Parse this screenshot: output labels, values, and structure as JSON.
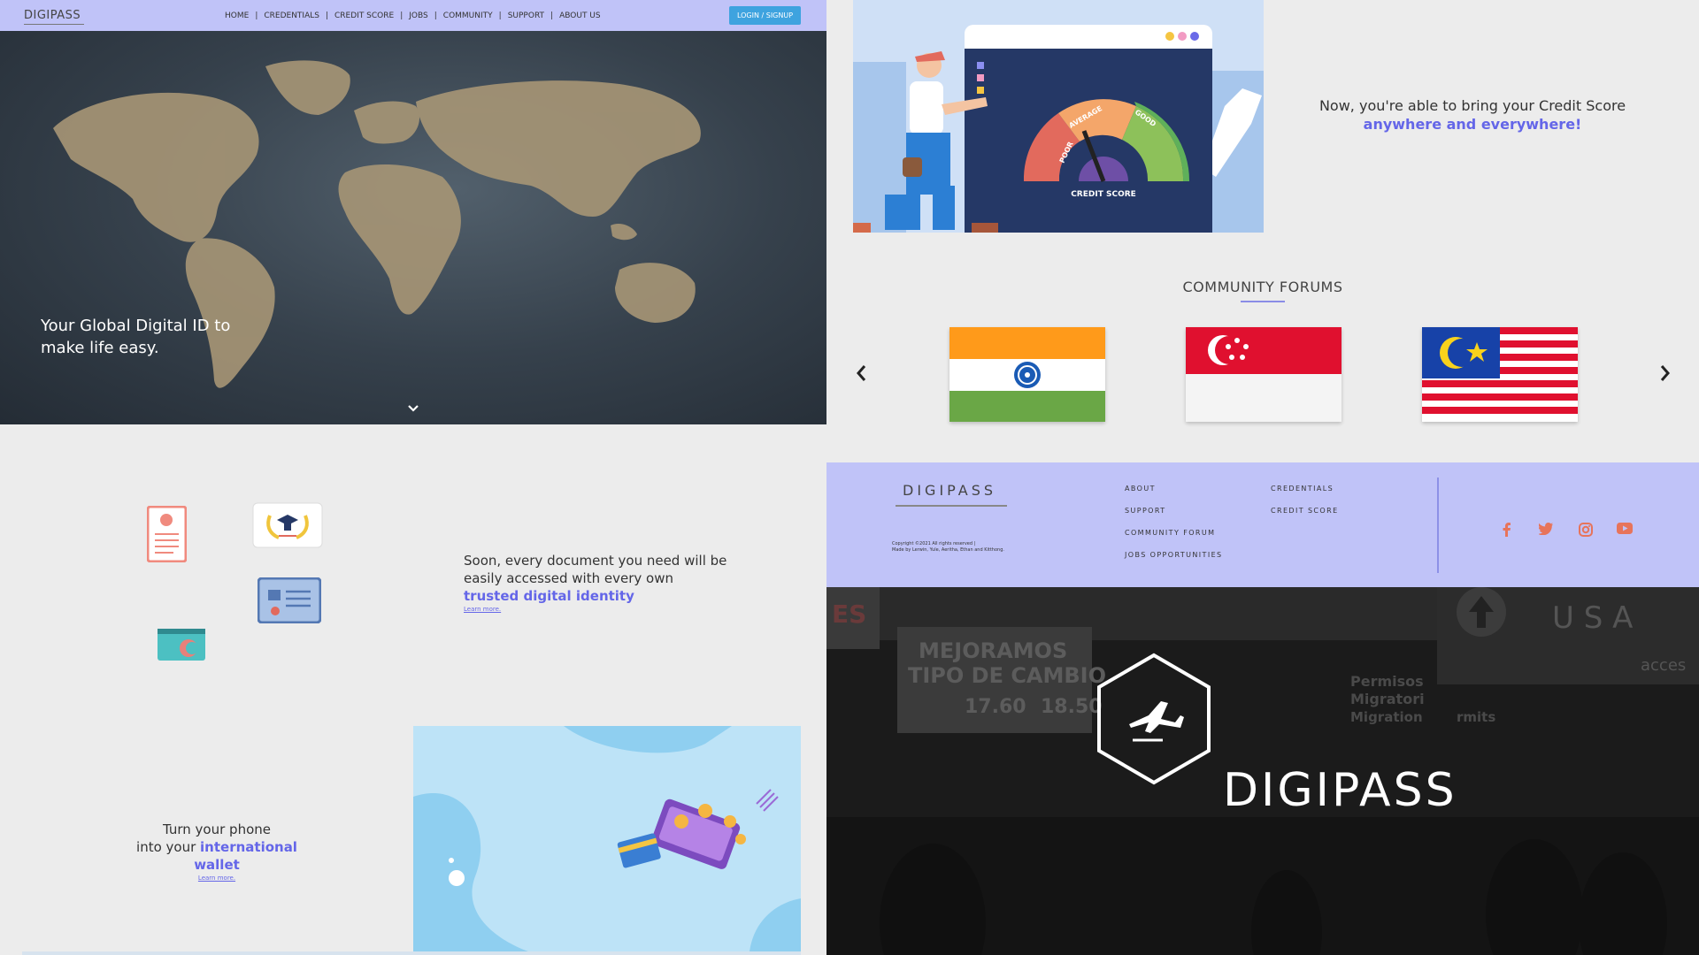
{
  "nav": {
    "logo": "DIGIPASS",
    "links": [
      "HOME",
      "CREDENTIALS",
      "CREDIT SCORE",
      "JOBS",
      "COMMUNITY",
      "SUPPORT",
      "ABOUT US"
    ],
    "separator": "|",
    "login_label": "LOGIN / SIGNUP"
  },
  "hero": {
    "tagline": "Your Global Digital ID to make life easy.",
    "scroll_icon": "chevron-down-icon"
  },
  "credit": {
    "gauge_labels": [
      "POOR",
      "AVERAGE",
      "GOOD"
    ],
    "gauge_caption": "CREDIT SCORE",
    "text_line1": "Now, you're able to bring your Credit Score",
    "text_highlight": "anywhere and everywhere!"
  },
  "forums": {
    "title": "COMMUNITY  FORUMS",
    "flags": [
      "india-flag",
      "singapore-flag",
      "malaysia-flag"
    ]
  },
  "documents": {
    "text": "Soon, every document you need will be easily accessed with every own",
    "highlight": "trusted digital identity",
    "learn_more": "Learn more."
  },
  "wallet": {
    "line1": "Turn your phone",
    "line2_prefix": "into your ",
    "highlight": "international wallet",
    "learn_more": "Learn more."
  },
  "footer": {
    "logo": "DIGIPASS",
    "copyright_line1": "Copyright ©2021 All rights reserved |",
    "copyright_line2": "Made by Lerwin, Yule, Aeritha, Ethan and Kitthong.",
    "col1": [
      "ABOUT",
      "SUPPORT",
      "COMMUNITY FORUM",
      "JOBS OPPORTUNITIES"
    ],
    "col2": [
      "CREDENTIALS",
      "CREDIT SCORE"
    ],
    "social_icons": [
      "facebook-icon",
      "twitter-icon",
      "instagram-icon",
      "youtube-icon"
    ]
  },
  "brand": {
    "name": "DIGIPASS",
    "sign_lines": [
      "MEJORAMOS",
      "TIPO DE CAMBIO",
      "17.60",
      "18.50"
    ],
    "sign_right": [
      "Permisos",
      "Migratori",
      "Migration",
      "rmits",
      "U S A",
      "acces"
    ],
    "sign_left": "ES"
  },
  "colors": {
    "nav_bg": "#c0c3f8",
    "accent": "#6466e8",
    "button": "#3ea3df",
    "social": "#e7745b"
  }
}
